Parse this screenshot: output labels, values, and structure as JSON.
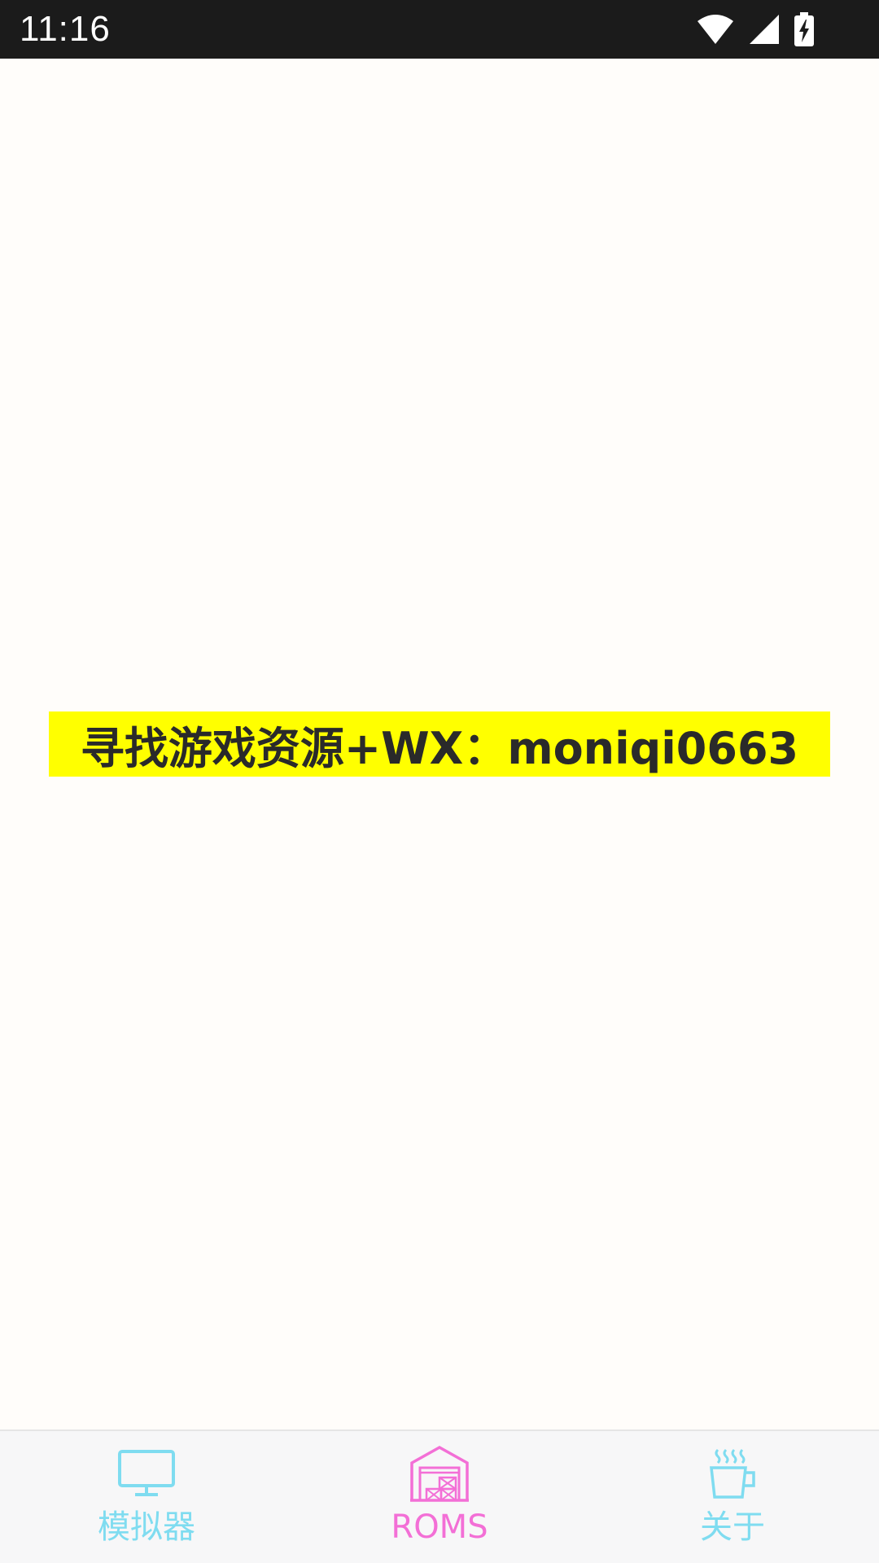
{
  "status_bar": {
    "time": "11:16",
    "icons": [
      "wifi-icon",
      "signal-icon",
      "battery-charging-icon"
    ]
  },
  "banner": {
    "text": "寻找游戏资源+WX：moniqi0663"
  },
  "bottom_nav": {
    "items": [
      {
        "label": "模拟器",
        "icon": "monitor-icon",
        "active": false
      },
      {
        "label": "ROMS",
        "icon": "warehouse-icon",
        "active": true
      },
      {
        "label": "关于",
        "icon": "coffee-cup-icon",
        "active": false
      }
    ]
  },
  "colors": {
    "status_bar_bg": "#1b1b1b",
    "page_bg": "#fffdfa",
    "banner_bg": "#ffff00",
    "nav_inactive": "#7fdcf0",
    "nav_active": "#f36fd6"
  }
}
